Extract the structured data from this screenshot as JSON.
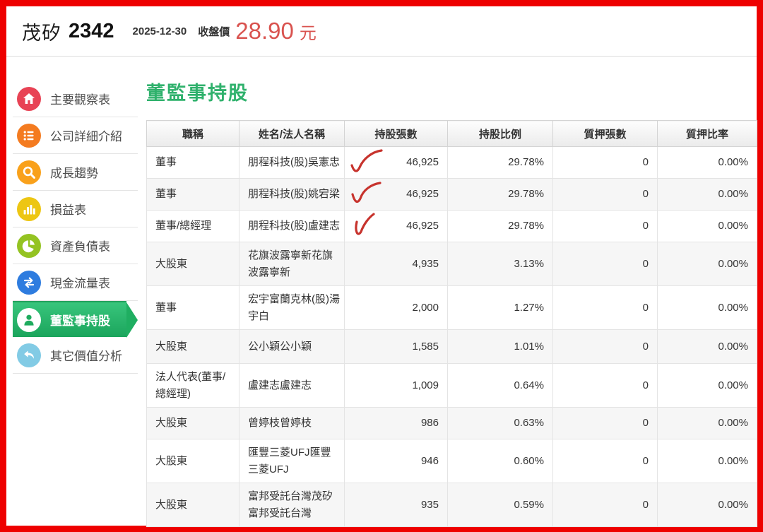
{
  "page": {
    "border_color": "#ee0000",
    "accent_green": "#2fb16c",
    "price_red": "#d9534f"
  },
  "header": {
    "stock_name": "茂矽",
    "stock_code": "2342",
    "date": "2025-12-30",
    "price_label": "收盤價",
    "price_value": "28.90",
    "price_unit": "元"
  },
  "sidebar": {
    "items": [
      {
        "label": "主要觀察表",
        "icon": "home-icon",
        "color": "#e84355",
        "selected": false
      },
      {
        "label": "公司詳細介紹",
        "icon": "list-icon",
        "color": "#f47b20",
        "selected": false
      },
      {
        "label": "成長趨勢",
        "icon": "search-icon",
        "color": "#f9a11b",
        "selected": false
      },
      {
        "label": "損益表",
        "icon": "bar-chart-icon",
        "color": "#edc613",
        "selected": false
      },
      {
        "label": "資產負債表",
        "icon": "pie-chart-icon",
        "color": "#94c322",
        "selected": false
      },
      {
        "label": "現金流量表",
        "icon": "swap-arrows-icon",
        "color": "#2e7cdf",
        "selected": false
      },
      {
        "label": "董監事持股",
        "icon": "person-icon",
        "color": "#1fae61",
        "selected": true
      },
      {
        "label": "其它價值分析",
        "icon": "reply-arrow-icon",
        "color": "#82cbe5",
        "selected": false
      }
    ]
  },
  "main": {
    "title": "董監事持股",
    "table": {
      "columns": [
        "職稱",
        "姓名/法人名稱",
        "持股張數",
        "持股比例",
        "質押張數",
        "質押比率"
      ],
      "rows": [
        {
          "title": "董事",
          "name": "朋程科技(股)吳憲忠",
          "shares": "46,925",
          "ratio": "29.78%",
          "pledged": "0",
          "pledge_ratio": "0.00%",
          "checked": true
        },
        {
          "title": "董事",
          "name": "朋程科技(股)姚宕梁",
          "shares": "46,925",
          "ratio": "29.78%",
          "pledged": "0",
          "pledge_ratio": "0.00%",
          "checked": true
        },
        {
          "title": "董事/總經理",
          "name": "朋程科技(股)盧建志",
          "shares": "46,925",
          "ratio": "29.78%",
          "pledged": "0",
          "pledge_ratio": "0.00%",
          "checked": true
        },
        {
          "title": "大股東",
          "name": "花旗波露寧新花旗波露寧新",
          "shares": "4,935",
          "ratio": "3.13%",
          "pledged": "0",
          "pledge_ratio": "0.00%",
          "checked": false
        },
        {
          "title": "董事",
          "name": "宏宇富蘭克林(股)湯宇白",
          "shares": "2,000",
          "ratio": "1.27%",
          "pledged": "0",
          "pledge_ratio": "0.00%",
          "checked": false
        },
        {
          "title": "大股東",
          "name": "公小穎公小穎",
          "shares": "1,585",
          "ratio": "1.01%",
          "pledged": "0",
          "pledge_ratio": "0.00%",
          "checked": false
        },
        {
          "title": "法人代表(董事/總經理)",
          "name": "盧建志盧建志",
          "shares": "1,009",
          "ratio": "0.64%",
          "pledged": "0",
          "pledge_ratio": "0.00%",
          "checked": false
        },
        {
          "title": "大股東",
          "name": "曾婷枝曾婷枝",
          "shares": "986",
          "ratio": "0.63%",
          "pledged": "0",
          "pledge_ratio": "0.00%",
          "checked": false
        },
        {
          "title": "大股東",
          "name": "匯豐三菱UFJ匯豐三菱UFJ",
          "shares": "946",
          "ratio": "0.60%",
          "pledged": "0",
          "pledge_ratio": "0.00%",
          "checked": false
        },
        {
          "title": "大股東",
          "name": "富邦受託台灣茂矽富邦受託台灣",
          "shares": "935",
          "ratio": "0.59%",
          "pledged": "0",
          "pledge_ratio": "0.00%",
          "checked": false
        }
      ]
    }
  }
}
